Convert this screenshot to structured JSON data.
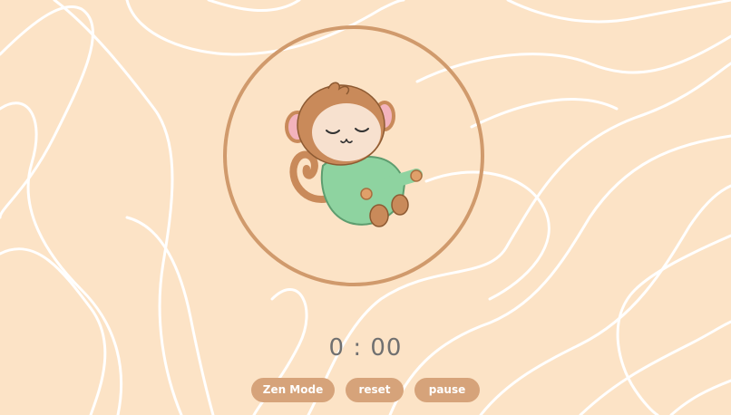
{
  "timer": {
    "display": "0 : 00"
  },
  "controls": {
    "zen_mode_label": "Zen Mode",
    "reset_label": "reset",
    "pause_label": "pause"
  },
  "theme": {
    "background": "#fce3c6",
    "accent": "#d6a37a",
    "ring": "#d09a6c",
    "timer_text": "#707070"
  },
  "avatar": {
    "icon": "meditating-monkey-icon"
  }
}
